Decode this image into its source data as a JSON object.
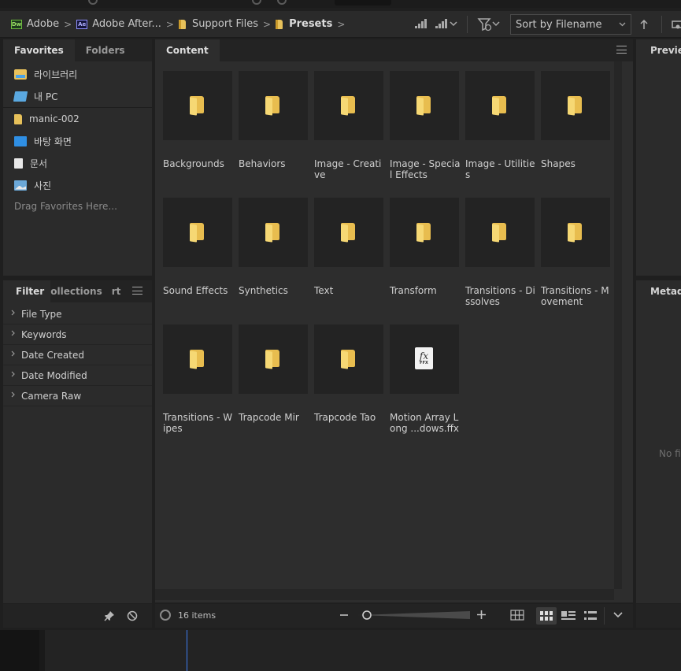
{
  "breadcrumb": {
    "items": [
      {
        "label": "Adobe",
        "icon": "dreamweaver-icon"
      },
      {
        "label": "Adobe After...",
        "icon": "after-effects-icon"
      },
      {
        "label": "Support Files",
        "icon": "folder-icon"
      },
      {
        "label": "Presets",
        "icon": "folder-icon"
      }
    ],
    "separator": ">"
  },
  "toolbar": {
    "sort_label": "Sort by Filename",
    "icons": [
      "quality-icon",
      "thumbnail-quality-icon",
      "filter-icon",
      "sort-ascending-icon",
      "workflow-icon"
    ]
  },
  "left_panel": {
    "tabs": [
      "Favorites",
      "Folders"
    ],
    "favorites": [
      {
        "label": "라이브러리",
        "icon": "library-icon"
      },
      {
        "label": "내 PC",
        "icon": "pc-icon"
      },
      {
        "label": "manic-002",
        "icon": "folder-icon"
      },
      {
        "label": "바탕 화면",
        "icon": "desktop-icon"
      },
      {
        "label": "문서",
        "icon": "documents-icon"
      },
      {
        "label": "사진",
        "icon": "pictures-icon"
      }
    ],
    "drag_hint": "Drag Favorites Here..."
  },
  "filter_panel": {
    "tabs": [
      "Filter",
      "ollections",
      "rt"
    ],
    "items": [
      "File Type",
      "Keywords",
      "Date Created",
      "Date Modified",
      "Camera Raw"
    ]
  },
  "content_panel": {
    "tab": "Content",
    "items": [
      {
        "label": "Backgrounds",
        "kind": "folder"
      },
      {
        "label": "Behaviors",
        "kind": "folder"
      },
      {
        "label": "Image - Creative",
        "kind": "folder"
      },
      {
        "label": "Image - Special Effects",
        "kind": "folder"
      },
      {
        "label": "Image - Utilities",
        "kind": "folder"
      },
      {
        "label": "Shapes",
        "kind": "folder"
      },
      {
        "label": "Sound Effects",
        "kind": "folder"
      },
      {
        "label": "Synthetics",
        "kind": "folder"
      },
      {
        "label": "Text",
        "kind": "folder"
      },
      {
        "label": "Transform",
        "kind": "folder"
      },
      {
        "label": "Transitions - Dissolves",
        "kind": "folder"
      },
      {
        "label": "Transitions - Movement",
        "kind": "folder"
      },
      {
        "label": "Transitions - Wipes",
        "kind": "folder"
      },
      {
        "label": "Trapcode Mir",
        "kind": "folder"
      },
      {
        "label": "Trapcode Tao",
        "kind": "folder"
      },
      {
        "label": "Motion Array Long ...dows.ffx",
        "kind": "ffx",
        "badge_fx": "fx",
        "badge_ext": "FFX"
      }
    ],
    "item_count": "16 items"
  },
  "preview_panel": {
    "tab": "Preview"
  },
  "metadata_panel": {
    "tab": "Metadata",
    "empty_text": "No fil"
  },
  "colors": {
    "folder": "#e8bd4f",
    "panel": "#2b2b2b",
    "tile": "#232323"
  }
}
